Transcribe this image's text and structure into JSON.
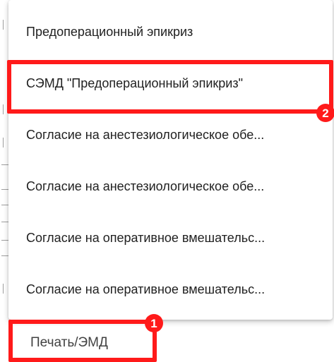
{
  "menu": {
    "items": [
      {
        "label": "Предоперационный эпикриз"
      },
      {
        "label": "СЭМД \"Предоперационный эпикриз\""
      },
      {
        "label": "Согласие на анестезиологическое обе..."
      },
      {
        "label": "Согласие на анестезиологическое обе..."
      },
      {
        "label": "Согласие на оперативное вмешательс..."
      },
      {
        "label": "Согласие на оперативное вмешательс..."
      }
    ]
  },
  "print_button": {
    "label": "Печать/ЭМД"
  },
  "annotations": {
    "badge_1": "1",
    "badge_2": "2",
    "highlight_color": "#ff1a1a"
  }
}
